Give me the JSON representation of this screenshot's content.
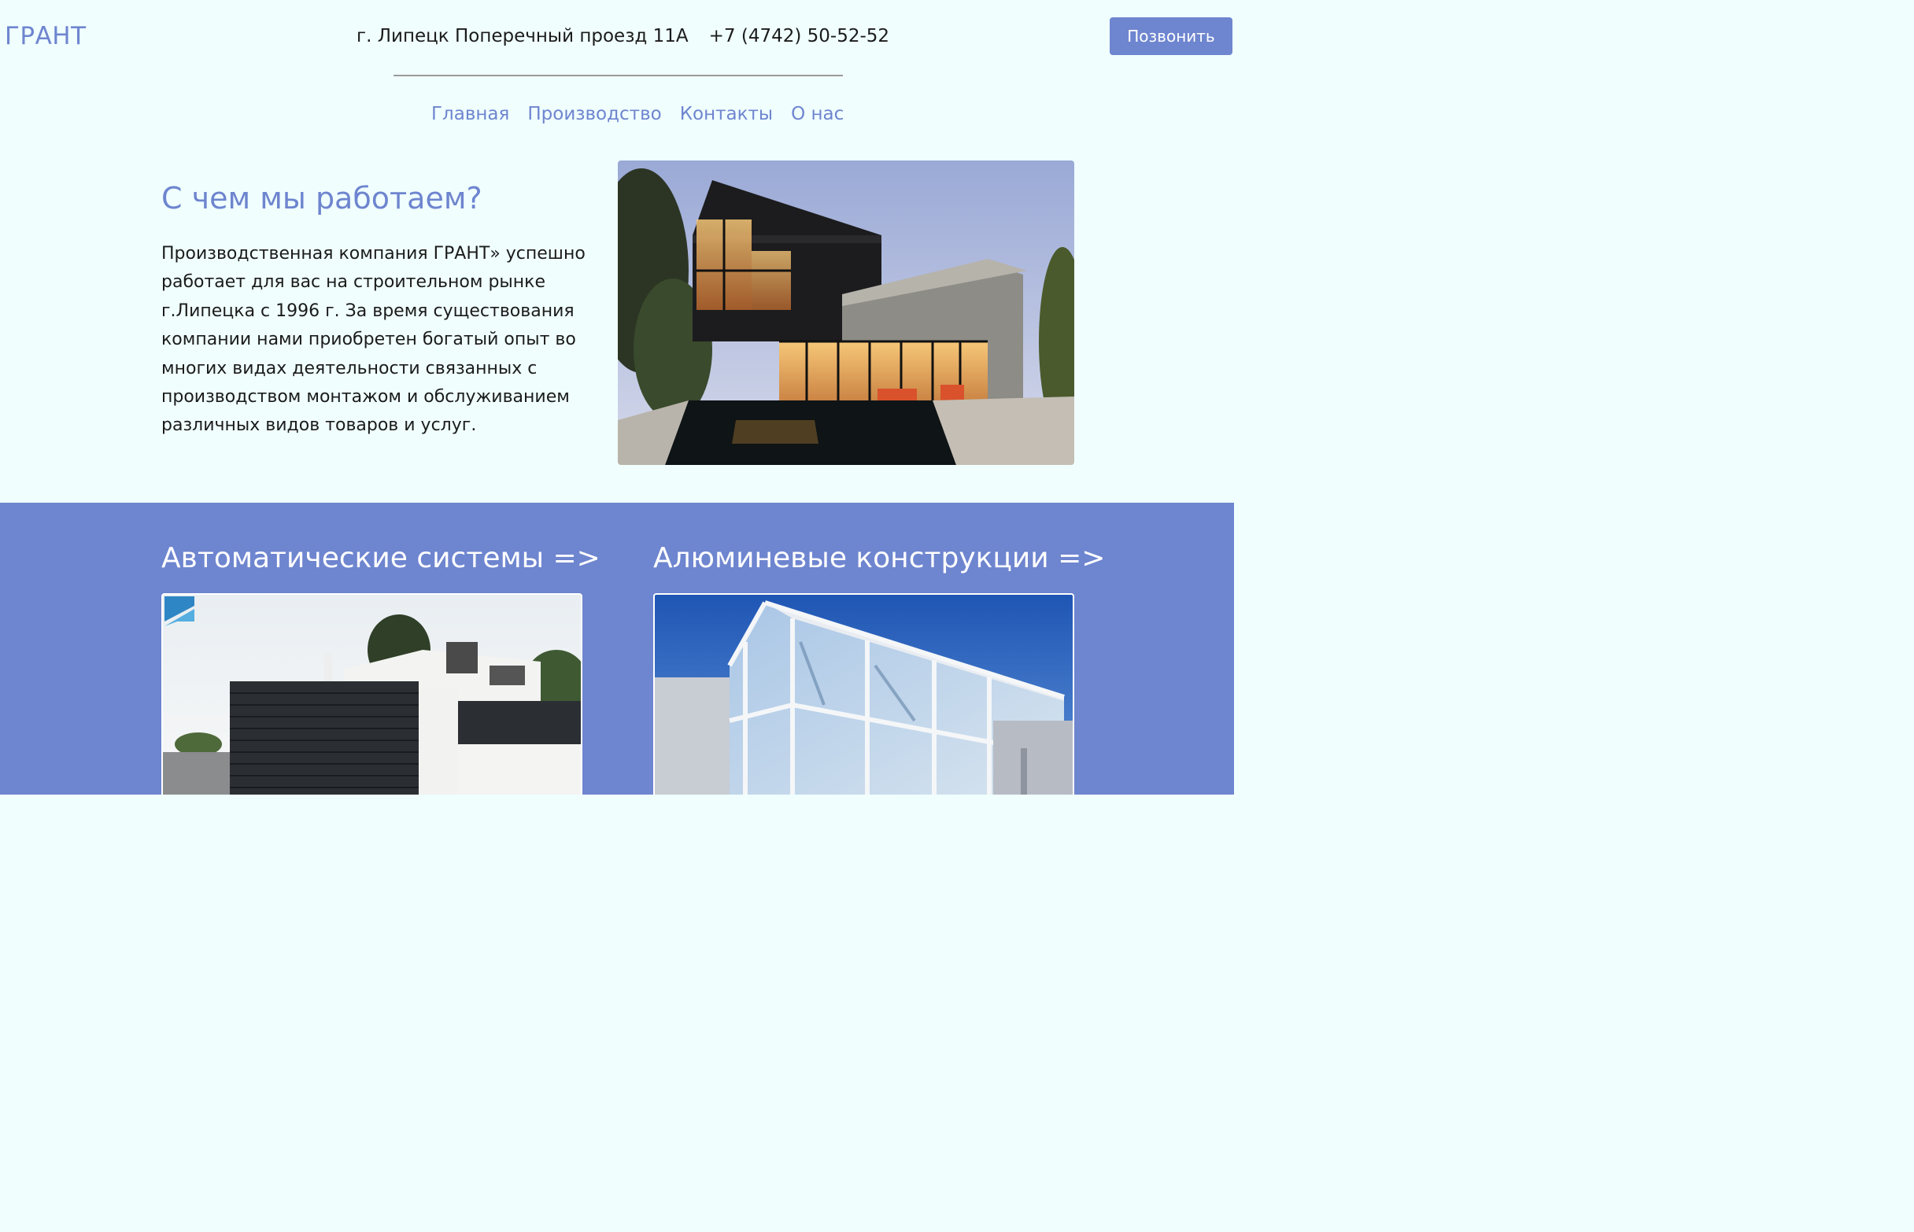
{
  "header": {
    "logo": "ГРАНТ",
    "address": "г. Липецк Поперечный проезд 11А",
    "phone": "+7 (4742) 50-52-52",
    "call_button": "Позвонить"
  },
  "nav": [
    {
      "label": "Главная"
    },
    {
      "label": "Производство"
    },
    {
      "label": "Контакты"
    },
    {
      "label": "О нас"
    }
  ],
  "intro": {
    "title": "С чем мы работаем?",
    "text_lines": [
      "Производственная компания ГРАНТ» успешно",
      "работает для вас на строительном рынке",
      "г.Липецка с 1996 г. За время существования",
      "компании нами приобретен богатый опыт во",
      "многих видах деятельности связанных с",
      "производством монтажом и обслуживанием",
      "различных видов товаров и услуг."
    ],
    "image_icon": "modern-house-photo"
  },
  "services": [
    {
      "title": "Автоматические системы =>",
      "image_icon": "automatic-gate-photo"
    },
    {
      "title": "Алюминевые конструкции =>",
      "image_icon": "aluminum-glass-structure-photo"
    }
  ],
  "colors": {
    "accent": "#6e85cf",
    "background": "#f0fffe",
    "text": "#1b1b1b"
  }
}
